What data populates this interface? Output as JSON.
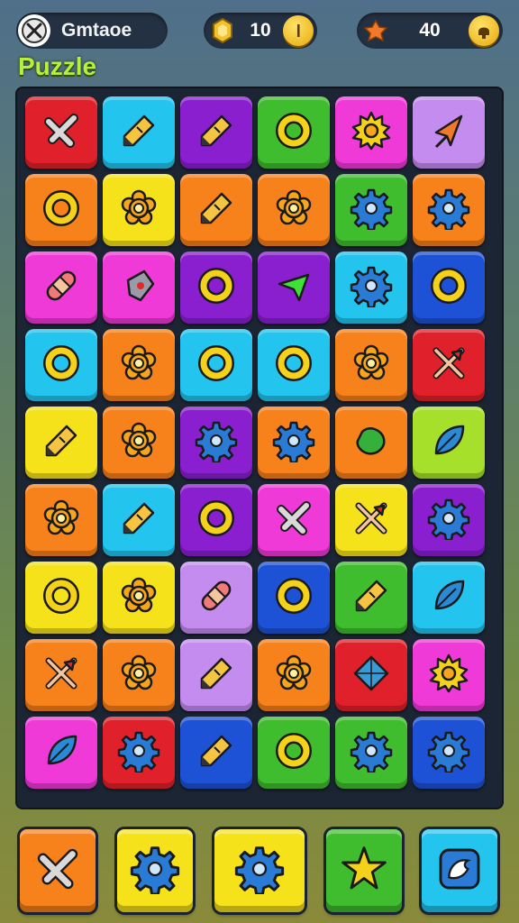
{
  "header": {
    "player_name": "Gmtaoe",
    "coins": "10",
    "gems": "40"
  },
  "title": "Puzzle",
  "colors": {
    "red": "#e0202a",
    "cyan": "#23c4ee",
    "purple": "#8a1fd0",
    "green": "#3fbd2e",
    "magenta": "#f03ad8",
    "lavender": "#c58cf0",
    "orange": "#f7811a",
    "yellow": "#f5e21a",
    "blue": "#1e52d6",
    "lime": "#a6e02a"
  },
  "board": [
    [
      {
        "color": "red",
        "icon": "cross-icon"
      },
      {
        "color": "cyan",
        "icon": "pencil-icon"
      },
      {
        "color": "purple",
        "icon": "pencil-icon"
      },
      {
        "color": "green",
        "icon": "ring-icon"
      },
      {
        "color": "magenta",
        "icon": "sun-icon"
      },
      {
        "color": "lavender",
        "icon": "arrowhead-icon"
      }
    ],
    [
      {
        "color": "orange",
        "icon": "ring-icon"
      },
      {
        "color": "yellow",
        "icon": "flower-icon"
      },
      {
        "color": "orange",
        "icon": "pencil-icon"
      },
      {
        "color": "orange",
        "icon": "flower-icon"
      },
      {
        "color": "green",
        "icon": "gear-icon"
      },
      {
        "color": "orange",
        "icon": "gear-icon"
      }
    ],
    [
      {
        "color": "magenta",
        "icon": "bandage-icon"
      },
      {
        "color": "magenta",
        "icon": "shield-icon"
      },
      {
        "color": "purple",
        "icon": "ring-icon"
      },
      {
        "color": "purple",
        "icon": "arrow-icon"
      },
      {
        "color": "cyan",
        "icon": "gear-icon"
      },
      {
        "color": "blue",
        "icon": "ring-icon"
      }
    ],
    [
      {
        "color": "cyan",
        "icon": "ring-icon"
      },
      {
        "color": "orange",
        "icon": "flower-icon"
      },
      {
        "color": "cyan",
        "icon": "ring-icon"
      },
      {
        "color": "cyan",
        "icon": "ring-icon"
      },
      {
        "color": "orange",
        "icon": "flower-icon"
      },
      {
        "color": "red",
        "icon": "crossed-arrows-icon"
      }
    ],
    [
      {
        "color": "yellow",
        "icon": "pencil-icon"
      },
      {
        "color": "orange",
        "icon": "flower-icon"
      },
      {
        "color": "purple",
        "icon": "gear-icon"
      },
      {
        "color": "orange",
        "icon": "gear-icon"
      },
      {
        "color": "orange",
        "icon": "blob-icon"
      },
      {
        "color": "lime",
        "icon": "leaf-icon"
      }
    ],
    [
      {
        "color": "orange",
        "icon": "flower-icon"
      },
      {
        "color": "cyan",
        "icon": "pencil-icon"
      },
      {
        "color": "purple",
        "icon": "ring-icon"
      },
      {
        "color": "magenta",
        "icon": "cross-icon"
      },
      {
        "color": "yellow",
        "icon": "crossed-arrows-icon"
      },
      {
        "color": "purple",
        "icon": "gear-icon"
      }
    ],
    [
      {
        "color": "yellow",
        "icon": "ring-icon"
      },
      {
        "color": "yellow",
        "icon": "flower-icon"
      },
      {
        "color": "lavender",
        "icon": "bandage-icon"
      },
      {
        "color": "blue",
        "icon": "ring-icon"
      },
      {
        "color": "green",
        "icon": "pencil-icon"
      },
      {
        "color": "cyan",
        "icon": "leaf-icon"
      }
    ],
    [
      {
        "color": "orange",
        "icon": "crossed-arrows-icon"
      },
      {
        "color": "orange",
        "icon": "flower-icon"
      },
      {
        "color": "lavender",
        "icon": "pencil-icon"
      },
      {
        "color": "orange",
        "icon": "flower-icon"
      },
      {
        "color": "red",
        "icon": "diamond-icon"
      },
      {
        "color": "magenta",
        "icon": "sun-icon"
      }
    ],
    [
      {
        "color": "magenta",
        "icon": "leaf-icon"
      },
      {
        "color": "red",
        "icon": "gear-icon"
      },
      {
        "color": "blue",
        "icon": "pencil-icon"
      },
      {
        "color": "green",
        "icon": "ring-icon"
      },
      {
        "color": "green",
        "icon": "gear-icon"
      },
      {
        "color": "blue",
        "icon": "gear-icon"
      }
    ]
  ],
  "toolbar": [
    {
      "name": "hammer-button",
      "color": "orange",
      "icon": "cross-icon"
    },
    {
      "name": "shuffle-button",
      "color": "yellow",
      "icon": "gear-icon"
    },
    {
      "name": "bomb-button",
      "color": "yellow",
      "icon": "gear-icon"
    },
    {
      "name": "star-button",
      "color": "green",
      "icon": "star-icon"
    },
    {
      "name": "hint-button",
      "color": "cyan",
      "icon": "bird-icon"
    }
  ]
}
